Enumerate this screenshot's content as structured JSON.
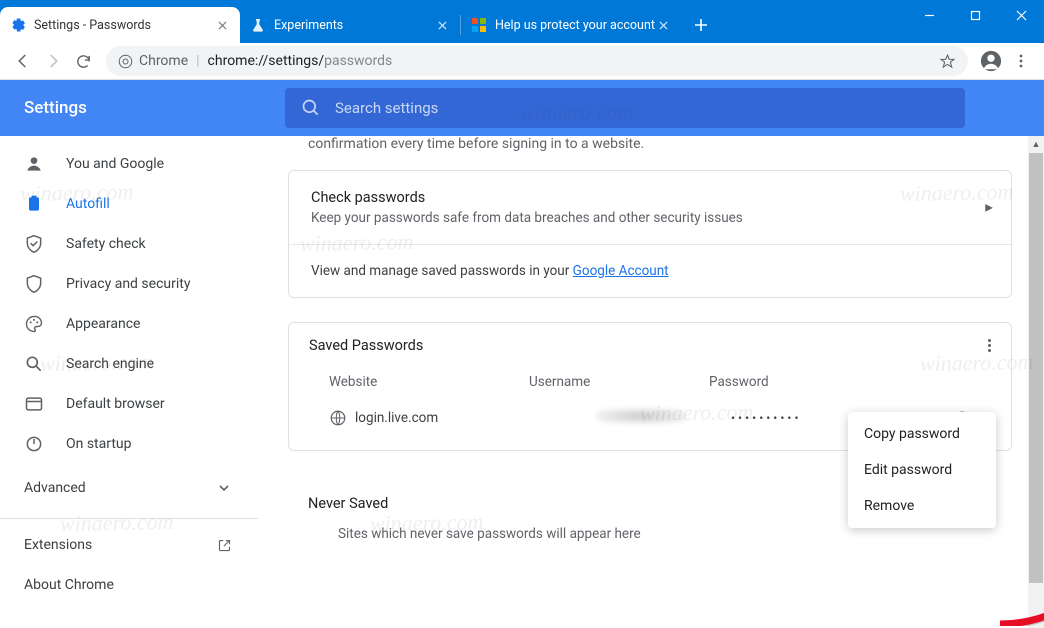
{
  "window": {
    "tabs": [
      {
        "title": "Settings - Passwords",
        "active": true
      },
      {
        "title": "Experiments",
        "active": false
      },
      {
        "title": "Help us protect your account",
        "active": false
      }
    ]
  },
  "toolbar": {
    "chrome_chip": "Chrome",
    "url_prefix": "chrome://settings/",
    "url_suffix": "passwords"
  },
  "header": {
    "title": "Settings",
    "search_placeholder": "Search settings"
  },
  "sidebar": {
    "items": [
      {
        "label": "You and Google"
      },
      {
        "label": "Autofill",
        "selected": true
      },
      {
        "label": "Safety check"
      },
      {
        "label": "Privacy and security"
      },
      {
        "label": "Appearance"
      },
      {
        "label": "Search engine"
      },
      {
        "label": "Default browser"
      },
      {
        "label": "On startup"
      }
    ],
    "advanced_label": "Advanced",
    "extensions_label": "Extensions",
    "about_label": "About Chrome"
  },
  "main": {
    "top_remnant": "confirmation every time before signing in to a website.",
    "check_title": "Check passwords",
    "check_sub": "Keep your passwords safe from data breaches and other security issues",
    "view_prefix": "View and manage saved passwords in your ",
    "view_link": "Google Account",
    "saved_heading": "Saved Passwords",
    "col_website": "Website",
    "col_username": "Username",
    "col_password": "Password",
    "row_site": "login.live.com",
    "row_password_masked": "••••••••••",
    "never_heading": "Never Saved",
    "never_msg": "Sites which never save passwords will appear here",
    "menu": {
      "copy": "Copy password",
      "edit": "Edit password",
      "remove": "Remove"
    }
  },
  "watermark": "winaero.com"
}
